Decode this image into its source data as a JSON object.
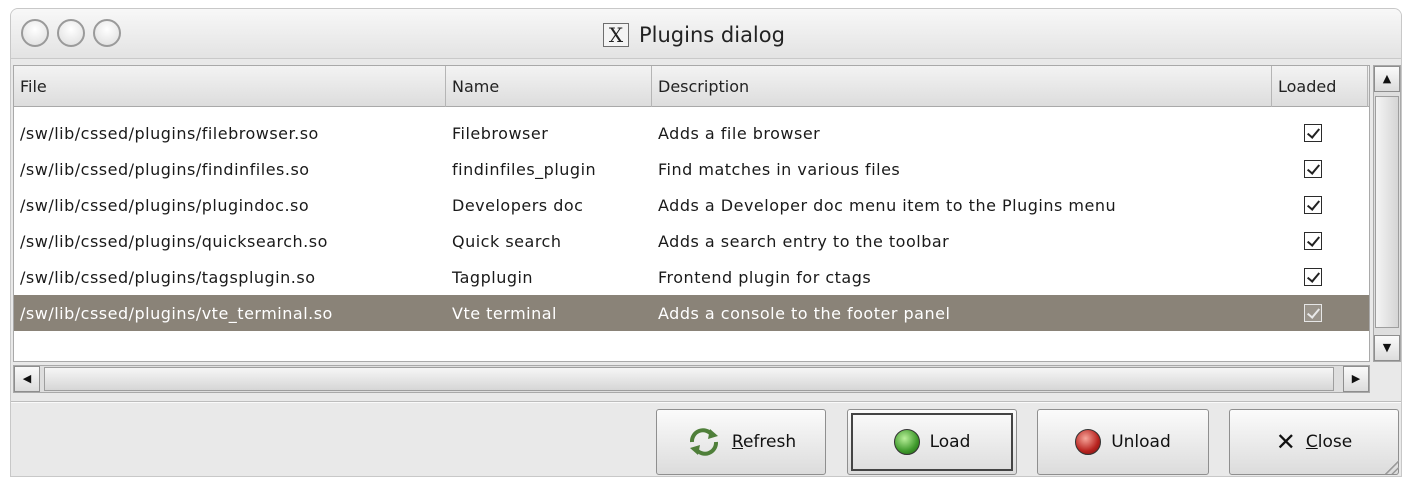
{
  "window": {
    "title": "Plugins dialog",
    "title_icon": "x-window-icon",
    "traffic_lights": [
      "close",
      "minimize",
      "zoom"
    ]
  },
  "table": {
    "columns": [
      "File",
      "Name",
      "Description",
      "Loaded"
    ],
    "rows": [
      {
        "file": "/sw/lib/cssed/plugins/filebrowser.so",
        "name": "Filebrowser",
        "description": "Adds a file browser",
        "loaded": true
      },
      {
        "file": "/sw/lib/cssed/plugins/findinfiles.so",
        "name": "findinfiles_plugin",
        "description": "Find matches in various files",
        "loaded": true
      },
      {
        "file": "/sw/lib/cssed/plugins/plugindoc.so",
        "name": "Developers doc",
        "description": "Adds a Developer doc menu item to the Plugins menu",
        "loaded": true
      },
      {
        "file": "/sw/lib/cssed/plugins/quicksearch.so",
        "name": "Quick search",
        "description": "Adds a search entry to the toolbar",
        "loaded": true
      },
      {
        "file": "/sw/lib/cssed/plugins/tagsplugin.so",
        "name": "Tagplugin",
        "description": "Frontend plugin for ctags",
        "loaded": true
      },
      {
        "file": "/sw/lib/cssed/plugins/vte_terminal.so",
        "name": "Vte terminal",
        "description": "Adds a console to the footer panel",
        "loaded": true,
        "selected": true
      }
    ]
  },
  "buttons": {
    "refresh": {
      "mnemonic": "R",
      "rest": "efresh",
      "icon": "refresh-icon"
    },
    "load": {
      "label": "Load",
      "icon": "green-circle-icon",
      "color": "#3f9a2c"
    },
    "unload": {
      "label": "Unload",
      "icon": "red-circle-icon",
      "color": "#b8231f"
    },
    "close": {
      "mnemonic": "C",
      "rest": "lose",
      "icon": "close-x-icon"
    }
  },
  "colors": {
    "selected_row": "#8a8378",
    "window_bg": "#e9e9e9"
  }
}
